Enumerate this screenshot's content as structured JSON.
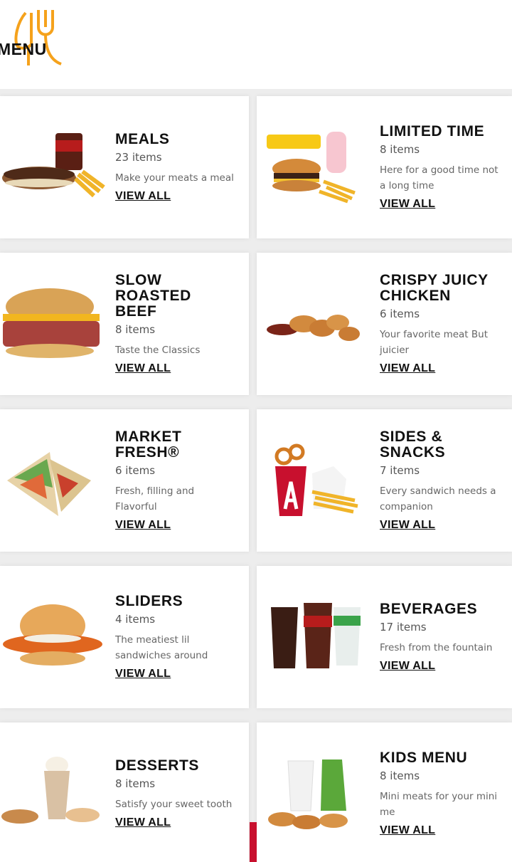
{
  "header": {
    "logo_text": "MENU",
    "accent_color": "#f5a21c"
  },
  "colors": {
    "brand_red": "#c8102e",
    "background": "#ededed"
  },
  "categories": [
    {
      "title": "MEALS",
      "count": "23 items",
      "desc": "Make your meats a meal",
      "link": "VIEW ALL",
      "image": "meal-combo-image"
    },
    {
      "title": "LIMITED TIME",
      "count": "8 items",
      "desc": "Here for a good time not a long time",
      "link": "VIEW ALL",
      "image": "good-burger-meal-image"
    },
    {
      "title": "SLOW ROASTED BEEF",
      "count": "8 items",
      "desc": "Taste the Classics",
      "link": "VIEW ALL",
      "image": "roast-beef-sandwich-image"
    },
    {
      "title": "CRISPY JUICY CHICKEN",
      "count": "6 items",
      "desc": "Your favorite meat But juicier",
      "link": "VIEW ALL",
      "image": "chicken-tenders-image"
    },
    {
      "title": "MARKET FRESH®",
      "count": "6 items",
      "desc": "Fresh, filling and Flavorful",
      "link": "VIEW ALL",
      "image": "wrap-image"
    },
    {
      "title": "SIDES & SNACKS",
      "count": "7 items",
      "desc": "Every sandwich needs a companion",
      "link": "VIEW ALL",
      "image": "curly-fries-image"
    },
    {
      "title": "SLIDERS",
      "count": "4 items",
      "desc": "The meatiest lil sandwiches around",
      "link": "VIEW ALL",
      "image": "chicken-slider-image"
    },
    {
      "title": "BEVERAGES",
      "count": "17 items",
      "desc": "Fresh from the fountain",
      "link": "VIEW ALL",
      "image": "fountain-drinks-image"
    },
    {
      "title": "DESSERTS",
      "count": "8 items",
      "desc": "Satisfy your sweet tooth",
      "link": "VIEW ALL",
      "image": "shake-cookies-image"
    },
    {
      "title": "KIDS MENU",
      "count": "8 items",
      "desc": "Mini meats for your mini me",
      "link": "VIEW ALL",
      "image": "kids-meal-image"
    }
  ]
}
